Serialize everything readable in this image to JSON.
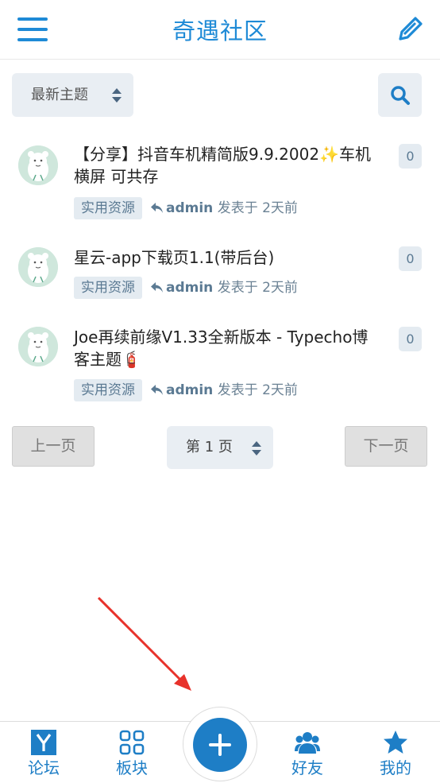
{
  "header": {
    "title": "奇遇社区",
    "menu_icon": "menu-icon",
    "edit_icon": "edit-icon"
  },
  "toolbar": {
    "sort_label": "最新主题",
    "sort_icon": "sort-updown-icon",
    "search_icon": "search-icon"
  },
  "topics": [
    {
      "title": "【分享】抖音车机精简版9.9.2002✨车机横屏 可共存",
      "count": "0",
      "tag": "实用资源",
      "author": "admin",
      "posted": "发表于 2天前"
    },
    {
      "title": "星云-app下载页1.1(带后台)",
      "count": "0",
      "tag": "实用资源",
      "author": "admin",
      "posted": "发表于 2天前"
    },
    {
      "title": "Joe再续前缘V1.33全新版本 - Typecho博客主题🧯",
      "count": "0",
      "tag": "实用资源",
      "author": "admin",
      "posted": "发表于 2天前"
    }
  ],
  "pagination": {
    "prev_label": "上一页",
    "page_label": "第 1 页",
    "next_label": "下一页"
  },
  "bottom_nav": {
    "items": [
      {
        "label": "论坛",
        "icon": "forum-y-icon"
      },
      {
        "label": "板块",
        "icon": "grid-icon"
      },
      {
        "label": "好友",
        "icon": "friends-icon"
      },
      {
        "label": "我的",
        "icon": "star-icon"
      }
    ],
    "fab_icon": "plus-icon"
  },
  "colors": {
    "accent": "#1e8ad6",
    "nav": "#1e7ec6",
    "chip_bg": "#e4ebf1",
    "chip_text": "#5b7a93",
    "annotation": "#e8322b"
  }
}
